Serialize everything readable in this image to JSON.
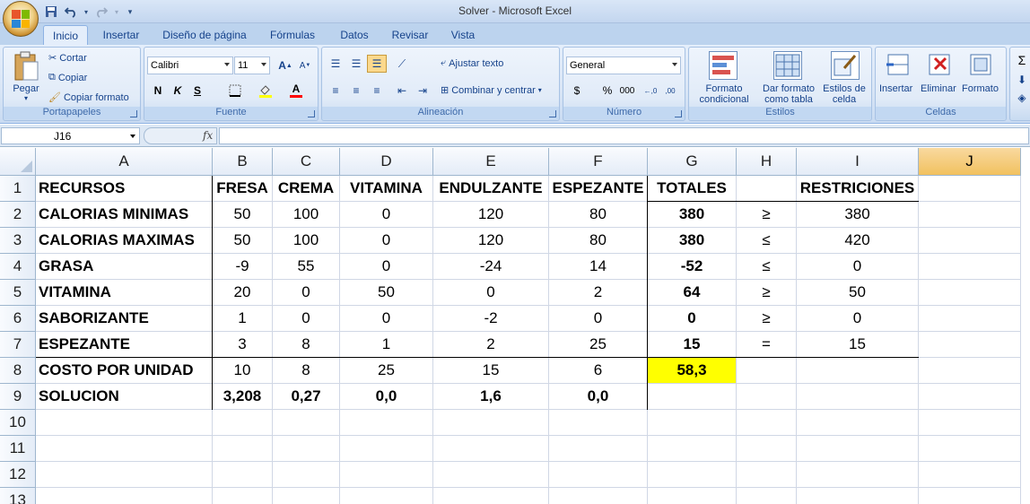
{
  "window": {
    "title": "Solver - Microsoft Excel"
  },
  "qat": {
    "icons": [
      "save-icon",
      "undo-icon",
      "redo-icon",
      "customize-icon"
    ]
  },
  "tabs": [
    {
      "label": "Inicio",
      "active": true
    },
    {
      "label": "Insertar"
    },
    {
      "label": "Diseño de página"
    },
    {
      "label": "Fórmulas"
    },
    {
      "label": "Datos"
    },
    {
      "label": "Revisar"
    },
    {
      "label": "Vista"
    }
  ],
  "ribbon": {
    "portapapeles": {
      "label": "Portapapeles",
      "paste": "Pegar",
      "cut": "Cortar",
      "copy": "Copiar",
      "format_painter": "Copiar formato"
    },
    "fuente": {
      "label": "Fuente",
      "font_name": "Calibri",
      "font_size": "11",
      "bold": "N",
      "italic": "K",
      "underline": "S",
      "grow": "A",
      "shrink": "A",
      "font_color": "A"
    },
    "alineacion": {
      "label": "Alineación",
      "wrap": "Ajustar texto",
      "merge": "Combinar y centrar"
    },
    "numero": {
      "label": "Número",
      "format": "General",
      "currency": "$",
      "percent": "%",
      "thousands": "000",
      "inc_decimal": "←,0 ,00",
      "dec_decimal": ",00 →,0"
    },
    "estilos": {
      "label": "Estilos",
      "cond_format_1": "Formato",
      "cond_format_2": "condicional",
      "table_format_1": "Dar formato",
      "table_format_2": "como tabla",
      "cell_styles_1": "Estilos de",
      "cell_styles_2": "celda"
    },
    "celdas": {
      "label": "Celdas",
      "insert": "Insertar",
      "delete": "Eliminar",
      "format": "Formato"
    },
    "edicion": {
      "sum": "Σ"
    }
  },
  "formula_bar": {
    "name_box": "J16",
    "fx": "fx",
    "content": ""
  },
  "sheet": {
    "columns": [
      "A",
      "B",
      "C",
      "D",
      "E",
      "F",
      "G",
      "H",
      "I",
      "J"
    ],
    "selected_column": "J",
    "rows": [
      "1",
      "2",
      "3",
      "4",
      "5",
      "6",
      "7",
      "8",
      "9",
      "10",
      "11",
      "12",
      "13"
    ],
    "cells": [
      [
        "RECURSOS",
        "FRESA",
        "CREMA",
        "VITAMINA",
        "ENDULZANTE",
        "ESPEZANTE",
        "TOTALES",
        "",
        "RESTRICIONES",
        ""
      ],
      [
        "CALORIAS MINIMAS",
        "50",
        "100",
        "0",
        "120",
        "80",
        "380",
        "≥",
        "380",
        ""
      ],
      [
        "CALORIAS MAXIMAS",
        "50",
        "100",
        "0",
        "120",
        "80",
        "380",
        "≤",
        "420",
        ""
      ],
      [
        "GRASA",
        "-9",
        "55",
        "0",
        "-24",
        "14",
        "-52",
        "≤",
        "0",
        ""
      ],
      [
        "VITAMINA",
        "20",
        "0",
        "50",
        "0",
        "2",
        "64",
        "≥",
        "50",
        ""
      ],
      [
        "SABORIZANTE",
        "1",
        "0",
        "0",
        "-2",
        "0",
        "0",
        "≥",
        "0",
        ""
      ],
      [
        "ESPEZANTE",
        "3",
        "8",
        "1",
        "2",
        "25",
        "15",
        "=",
        "15",
        ""
      ],
      [
        "COSTO POR UNIDAD",
        "10",
        "8",
        "25",
        "15",
        "6",
        "58,3",
        "",
        "",
        ""
      ],
      [
        "SOLUCION",
        "3,208",
        "0,27",
        "0,0",
        "1,6",
        "0,0",
        "",
        "",
        "",
        ""
      ],
      [
        "",
        "",
        "",
        "",
        "",
        "",
        "",
        "",
        "",
        ""
      ],
      [
        "",
        "",
        "",
        "",
        "",
        "",
        "",
        "",
        "",
        ""
      ],
      [
        "",
        "",
        "",
        "",
        "",
        "",
        "",
        "",
        "",
        ""
      ],
      [
        "",
        "",
        "",
        "",
        "",
        "",
        "",
        "",
        "",
        ""
      ]
    ],
    "highlight_color": "#ffff00",
    "selection_color": "#f1c15f"
  }
}
